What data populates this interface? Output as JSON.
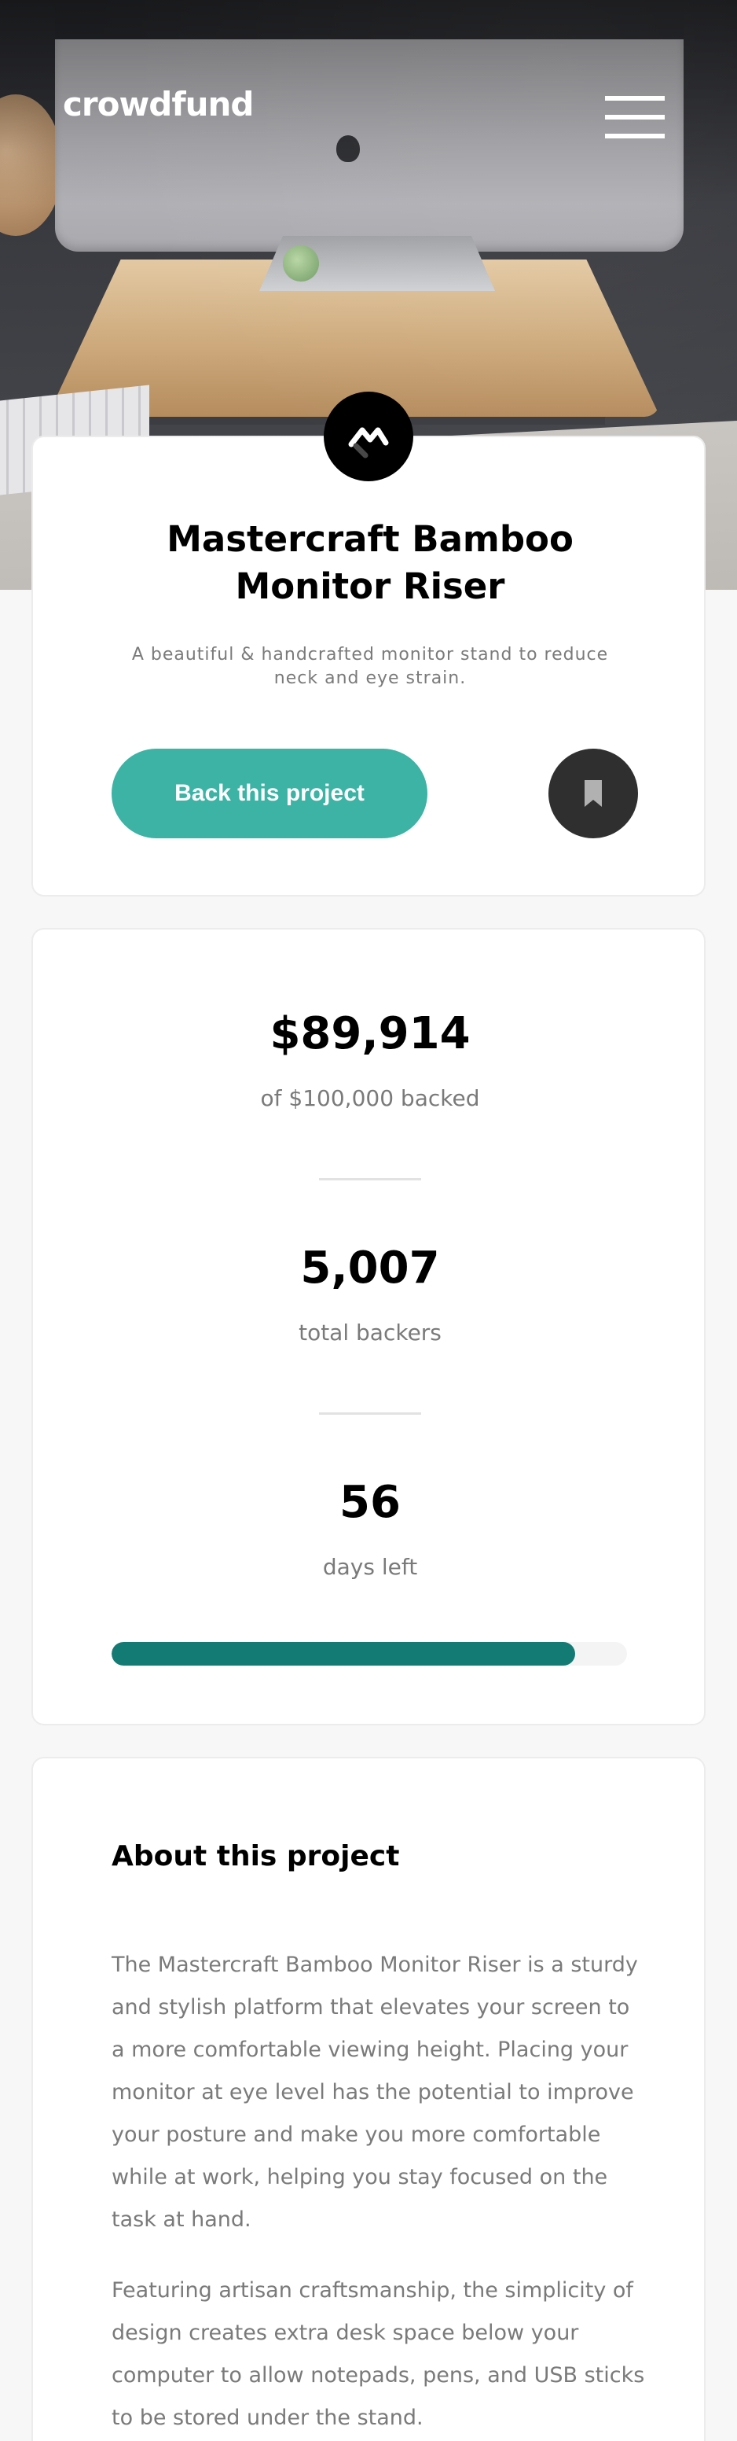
{
  "header": {
    "logo": "crowdfund",
    "menu_icon": "hamburger-icon"
  },
  "hero": {
    "image": "desk-monitor-photo"
  },
  "project": {
    "brand_icon": "mastercraft-logo-icon",
    "title_line1": "Mastercraft Bamboo",
    "title_line2": "Monitor Riser",
    "subtitle_line1": "A beautiful & handcrafted monitor stand to reduce",
    "subtitle_line2": "neck and eye strain.",
    "back_button": "Back this project",
    "bookmark_icon": "bookmark-icon"
  },
  "stats": {
    "backed_amount": "$89,914",
    "backed_label": "of $100,000 backed",
    "backers_count": "5,007",
    "backers_label": "total backers",
    "days_left": "56",
    "days_label": "days left",
    "progress_fraction": 0.89914
  },
  "about": {
    "heading": "About this project",
    "paragraphs": [
      "The Mastercraft Bamboo Monitor Riser is a sturdy and stylish platform that elevates your screen to a more comfortable viewing height. Placing your monitor at eye level has the potential to improve your posture and make you more comfortable while at work, helping you stay focused on the task at hand.",
      "Featuring artisan craftsmanship, the simplicity of design creates extra desk space below your computer to allow notepads, pens, and USB sticks to be stored under the stand."
    ]
  },
  "colors": {
    "accent": "#3cb3a5",
    "accent_dark": "#147b74",
    "text_muted": "#7a7a7a",
    "background": "#f7f7f7"
  }
}
